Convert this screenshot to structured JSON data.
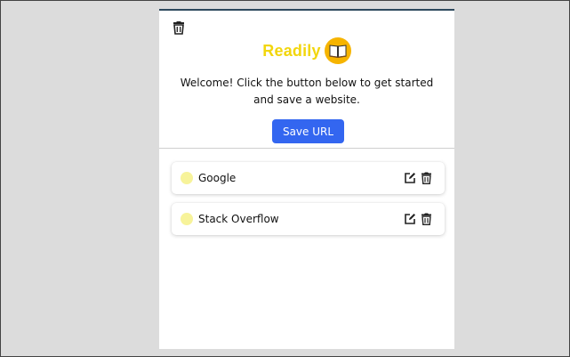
{
  "app": {
    "name": "Readily",
    "logo_icon": "open-book-icon",
    "brand_color": "#f2d60d"
  },
  "header": {
    "delete_all_icon": "trash-icon",
    "welcome_text": "Welcome! Click the button below to get started and save a website.",
    "save_button_label": "Save URL",
    "save_button_color": "#3366f0"
  },
  "bookmarks": [
    {
      "title": "Google",
      "dot_color": "#f7f39a",
      "edit_icon": "edit-icon",
      "delete_icon": "trash-icon"
    },
    {
      "title": "Stack Overflow",
      "dot_color": "#f7f39a",
      "edit_icon": "edit-icon",
      "delete_icon": "trash-icon"
    }
  ]
}
